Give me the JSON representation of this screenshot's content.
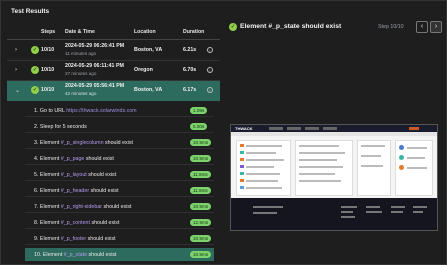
{
  "panel_title": "Test Results",
  "columns": {
    "steps": "Steps",
    "datetime": "Date & Time",
    "location": "Location",
    "duration": "Duration"
  },
  "runs": [
    {
      "steps": "10/10",
      "datetime": "2024-05-29 06:26:41 PM",
      "ago": "11 minutes ago",
      "location": "Boston, VA",
      "duration": "6.21s",
      "expanded": false
    },
    {
      "steps": "10/10",
      "datetime": "2024-05-29 06:11:41 PM",
      "ago": "27 minutes ago",
      "location": "Oregon",
      "duration": "6.70s",
      "expanded": false
    },
    {
      "steps": "10/10",
      "datetime": "2024-05-29 05:56:41 PM",
      "ago": "42 minutes ago",
      "location": "Boston, VA",
      "duration": "6.17s",
      "expanded": true
    }
  ],
  "steps": [
    {
      "num": "1.",
      "prefix": "Go to URL ",
      "highlight": "https://thwack.solarwinds.com",
      "suffix": "",
      "kind": "url",
      "duration": "1.09s"
    },
    {
      "num": "2.",
      "prefix": "Sleep for 5 seconds",
      "highlight": "",
      "suffix": "",
      "kind": "plain",
      "duration": "5.00s"
    },
    {
      "num": "3.",
      "prefix": "Element ",
      "highlight": "#_p_singlecolumn",
      "suffix": " should exist",
      "kind": "sel",
      "duration": "10.9ms"
    },
    {
      "num": "4.",
      "prefix": "Element ",
      "highlight": "#_p_page",
      "suffix": " should exist",
      "kind": "sel",
      "duration": "10.9ms"
    },
    {
      "num": "5.",
      "prefix": "Element ",
      "highlight": "#_p_layout",
      "suffix": " should exist",
      "kind": "sel",
      "duration": "11.9ms"
    },
    {
      "num": "6.",
      "prefix": "Element ",
      "highlight": "#_p_header",
      "suffix": " should exist",
      "kind": "sel",
      "duration": "11.9ms"
    },
    {
      "num": "7.",
      "prefix": "Element ",
      "highlight": "#_p_right-sidebar",
      "suffix": " should exist",
      "kind": "sel",
      "duration": "10.9ms"
    },
    {
      "num": "8.",
      "prefix": "Element ",
      "highlight": "#_p_content",
      "suffix": " should exist",
      "kind": "sel",
      "duration": "12.9ms"
    },
    {
      "num": "9.",
      "prefix": "Element ",
      "highlight": "#_p_footer",
      "suffix": " should exist",
      "kind": "sel",
      "duration": "10.9ms"
    },
    {
      "num": "10.",
      "prefix": "Element ",
      "highlight": "#_p_state",
      "suffix": " should exist",
      "kind": "sel",
      "duration": "10.9ms",
      "selected": true
    }
  ],
  "detail": {
    "title": "Element #_p_state should exist",
    "step_indicator": "Step 10/10",
    "prev_icon": "chevron-left-icon",
    "next_icon": "chevron-right-icon",
    "screenshot_logo": "THWACK"
  },
  "colors": {
    "accent_row": "#2e6b5f",
    "check_green": "#8fcf4a",
    "badge_green": "#7dd36b",
    "selector_purple": "#b49cf0"
  }
}
